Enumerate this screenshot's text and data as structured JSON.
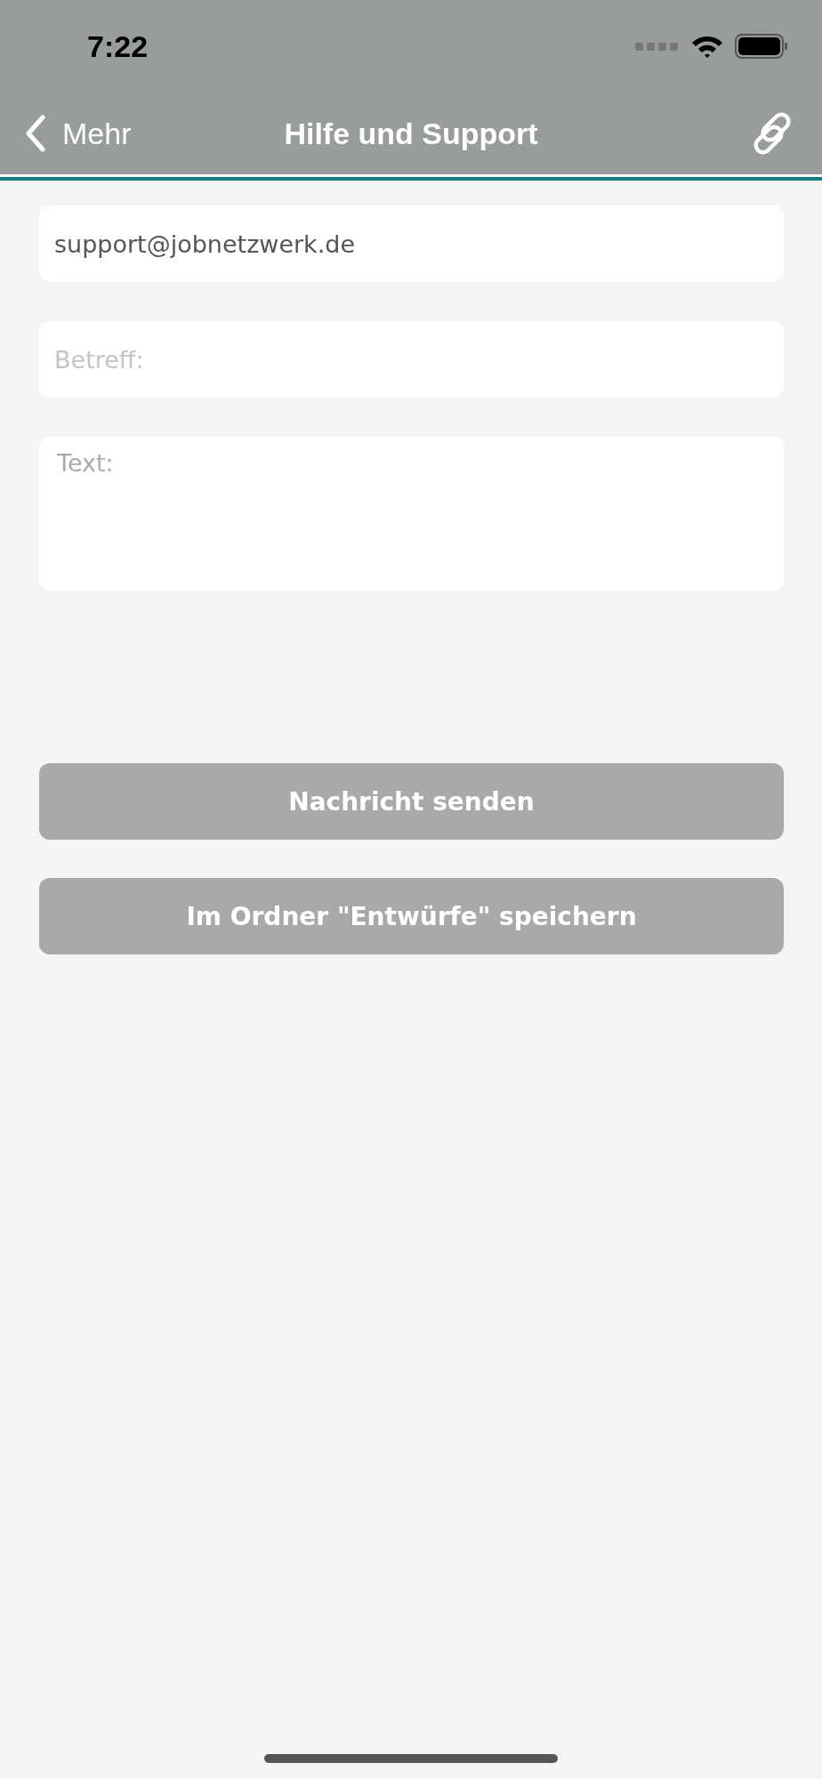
{
  "status_bar": {
    "time": "7:22"
  },
  "nav": {
    "back_label": "Mehr",
    "title": "Hilfe und Support"
  },
  "form": {
    "recipient": {
      "value": "support@jobnetzwerk.de"
    },
    "subject": {
      "placeholder": "Betreff:"
    },
    "message": {
      "placeholder": "Text:"
    }
  },
  "buttons": [
    {
      "label": "Nachricht senden"
    },
    {
      "label": "Im Ordner \"Entwürfe\" speichern"
    }
  ]
}
